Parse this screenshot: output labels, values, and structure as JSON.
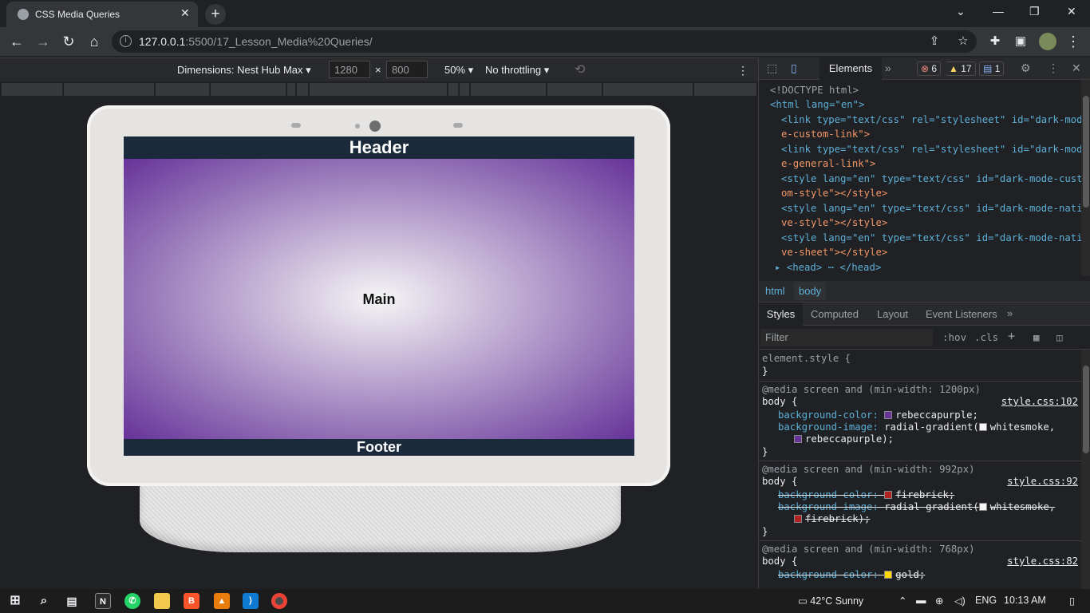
{
  "browser": {
    "tab_title": "CSS Media Queries",
    "tab_close": "✕",
    "new_tab": "+",
    "url_host": "127.0.0.1",
    "url_rest": ":5500/17_Lesson_Media%20Queries/",
    "window": {
      "chevron": "⌄",
      "minimize": "—",
      "restore": "❐",
      "close": "✕"
    }
  },
  "device_toolbar": {
    "dimensions_label": "Dimensions: Nest Hub Max ▾",
    "width": "1280",
    "times": "×",
    "height": "800",
    "zoom": "50% ▾",
    "throttling": "No throttling ▾"
  },
  "page": {
    "header": "Header",
    "main": "Main",
    "footer": "Footer"
  },
  "devtools": {
    "active_tab": "Elements",
    "more_tabs": "»",
    "errors": "6",
    "warnings": "17",
    "messages": "1",
    "dom_lines": [
      {
        "indent": 14,
        "html": "<!DOCTYPE html>"
      },
      {
        "indent": 14,
        "html": "<html lang=\"en\">"
      },
      {
        "indent": 28,
        "html": "<link type=\"text/css\" rel=\"stylesheet\" id=\"dark-mod"
      },
      {
        "indent": 28,
        "html": "e-custom-link\">"
      },
      {
        "indent": 28,
        "html": "<link type=\"text/css\" rel=\"stylesheet\" id=\"dark-mod"
      },
      {
        "indent": 28,
        "html": "e-general-link\">"
      },
      {
        "indent": 28,
        "html": "<style lang=\"en\" type=\"text/css\" id=\"dark-mode-cust"
      },
      {
        "indent": 28,
        "html": "om-style\"></style>"
      },
      {
        "indent": 28,
        "html": "<style lang=\"en\" type=\"text/css\" id=\"dark-mode-nati"
      },
      {
        "indent": 28,
        "html": "ve-style\"></style>"
      },
      {
        "indent": 28,
        "html": "<style lang=\"en\" type=\"text/css\" id=\"dark-mode-nati"
      },
      {
        "indent": 28,
        "html": "ve-sheet\"></style>"
      },
      {
        "indent": 20,
        "html": "▸ <head> ⋯ </head>"
      }
    ],
    "breadcrumbs": [
      "html",
      "body"
    ],
    "sub_tabs": [
      "Styles",
      "Computed",
      "Layout",
      "Event Listeners",
      "»"
    ],
    "filter_placeholder": "Filter",
    "hov": ":hov",
    "cls": ".cls",
    "element_style": "element.style {",
    "close_brace": "}",
    "rules": [
      {
        "media": "@media screen and (min-width: 1200px)",
        "selector": "body {",
        "link": "style.css:102",
        "bg_color": "rebeccapurple",
        "bg_image_a": "whitesmoke,",
        "bg_image_b": "rebeccapurple);",
        "swatch": "#663399",
        "struck": false
      },
      {
        "media": "@media screen and (min-width: 992px)",
        "selector": "body {",
        "link": "style.css:92",
        "bg_color": "firebrick;",
        "bg_image_a": "whitesmoke,",
        "bg_image_b": "firebrick);",
        "swatch": "#b22222",
        "struck": true
      },
      {
        "media": "@media screen and (min-width: 768px)",
        "selector": "body {",
        "link": "style.css:82",
        "bg_color": "gold;",
        "swatch": "#ffd700",
        "struck": true
      }
    ],
    "prop_bg_color": "background-color:",
    "prop_bg_image": "background-image:",
    "radial": "radial-gradient("
  },
  "taskbar": {
    "weather": "42°C  Sunny",
    "language": "ENG",
    "time": "10:13 AM"
  }
}
